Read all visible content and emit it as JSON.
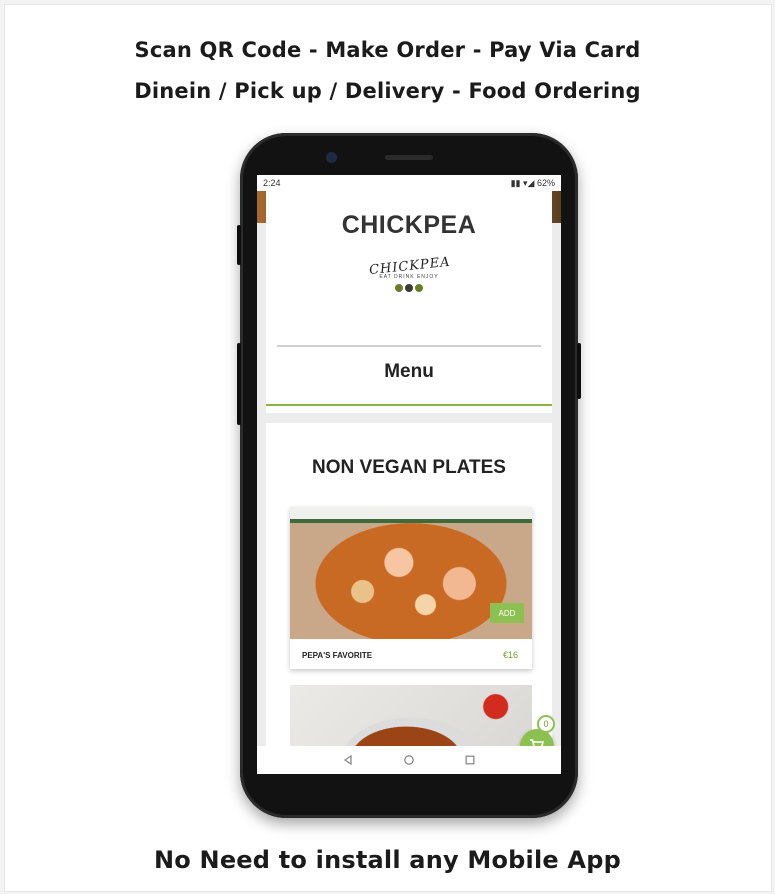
{
  "headline": {
    "line1": "Scan QR Code - Make Order - Pay Via Card",
    "line2": "Dinein / Pick up / Delivery - Food Ordering"
  },
  "footer": {
    "text": "No Need to install any Mobile App"
  },
  "phone": {
    "statusbar": {
      "time": "2:24",
      "battery": "62%"
    },
    "header": {
      "brand": "CHICKPEA",
      "logo_text": "CHICKPEA",
      "logo_tagline": "EAT DRINK ENJOY",
      "menu_title": "Menu"
    },
    "section": {
      "title": "NON VEGAN PLATES",
      "items": [
        {
          "name": "PEPA'S FAVORITE",
          "price": "€16",
          "add_label": "ADD"
        }
      ]
    },
    "cart": {
      "count": "0"
    },
    "navbar": {
      "back_icon": "back-triangle-icon",
      "home_icon": "home-circle-icon",
      "recents_icon": "recents-square-icon"
    }
  },
  "colors": {
    "accent_green": "#8cc152",
    "price_green": "#6f9f2f"
  }
}
